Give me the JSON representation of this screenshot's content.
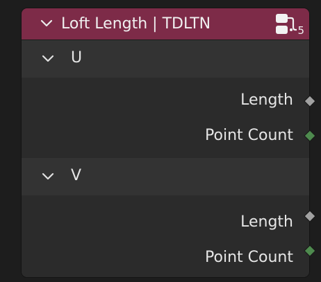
{
  "node": {
    "title": "Loft Length | TDLTN",
    "header_color": "#7d2b48",
    "node_icon": "node-group-icon",
    "node_icon_count": "5",
    "panels": [
      {
        "label": "U",
        "outputs": [
          {
            "label": "Length",
            "socket_type": "float",
            "socket_color": "#a1a1a1"
          },
          {
            "label": "Point Count",
            "socket_type": "integer",
            "socket_color": "#4e8a4e"
          }
        ]
      },
      {
        "label": "V",
        "outputs": [
          {
            "label": "Length",
            "socket_type": "float",
            "socket_color": "#a1a1a1"
          },
          {
            "label": "Point Count",
            "socket_type": "integer",
            "socket_color": "#4e8a4e"
          }
        ]
      }
    ]
  }
}
